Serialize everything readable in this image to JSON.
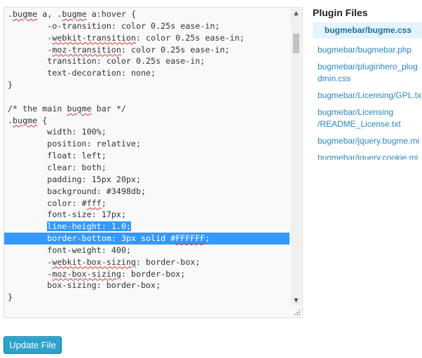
{
  "editor": {
    "lines": [
      [
        {
          "t": ".",
          "s": false
        },
        {
          "t": "bugme",
          "s": true
        },
        {
          "t": " a, .",
          "s": false
        },
        {
          "t": "bugme",
          "s": true
        },
        {
          "t": " a:hover {",
          "s": false
        }
      ],
      [
        {
          "t": "        -o-transition: color 0.25s ease-in;",
          "s": false
        }
      ],
      [
        {
          "t": "        -",
          "s": false
        },
        {
          "t": "webkit-transition",
          "s": true
        },
        {
          "t": ": color 0.25s ease-in;",
          "s": false
        }
      ],
      [
        {
          "t": "        -",
          "s": false
        },
        {
          "t": "moz-transition",
          "s": true
        },
        {
          "t": ": color 0.25s ease-in;",
          "s": false
        }
      ],
      [
        {
          "t": "        transition: color 0.25s ease-in;",
          "s": false
        }
      ],
      [
        {
          "t": "        text-decoration: none;",
          "s": false
        }
      ],
      [
        {
          "t": "}",
          "s": false
        }
      ],
      [
        {
          "t": "",
          "s": false
        }
      ],
      [
        {
          "t": "/* the main ",
          "s": false
        },
        {
          "t": "bugme",
          "s": true
        },
        {
          "t": " bar */",
          "s": false
        }
      ],
      [
        {
          "t": ".",
          "s": false
        },
        {
          "t": "bugme",
          "s": true
        },
        {
          "t": " {",
          "s": false
        }
      ],
      [
        {
          "t": "        width: 100%;",
          "s": false
        }
      ],
      [
        {
          "t": "        position: relative;",
          "s": false
        }
      ],
      [
        {
          "t": "        float: left;",
          "s": false
        }
      ],
      [
        {
          "t": "        clear: both;",
          "s": false
        }
      ],
      [
        {
          "t": "        padding: 15px 20px;",
          "s": false
        }
      ],
      [
        {
          "t": "        background: #3498db;",
          "s": false
        }
      ],
      [
        {
          "t": "        color: #",
          "s": false
        },
        {
          "t": "fff",
          "s": true
        },
        {
          "t": ";",
          "s": false
        }
      ],
      [
        {
          "t": "        font-size: 17px;",
          "s": false
        }
      ],
      [
        {
          "t": "        line-height: 1.0;",
          "s": false
        }
      ],
      [
        {
          "t": "        border-bottom: 3px solid #",
          "s": false
        },
        {
          "t": "FFFFFF",
          "s": true
        },
        {
          "t": ";",
          "s": false
        }
      ],
      [
        {
          "t": "        font-weight: 400;",
          "s": false
        }
      ],
      [
        {
          "t": "        -",
          "s": false
        },
        {
          "t": "webkit-box-sizing",
          "s": true
        },
        {
          "t": ": border-box;",
          "s": false
        }
      ],
      [
        {
          "t": "        -",
          "s": false
        },
        {
          "t": "moz-box-sizing",
          "s": true
        },
        {
          "t": ": border-box;",
          "s": false
        }
      ],
      [
        {
          "t": "        box-sizing: border-box;",
          "s": false
        }
      ],
      [
        {
          "t": "}",
          "s": false
        }
      ],
      [
        {
          "t": "",
          "s": false
        }
      ]
    ],
    "selection_partial_line": 18,
    "selection_full_line": 19,
    "scroll_up_icon": "▲",
    "scroll_down_icon": "▼"
  },
  "update_button": {
    "label": "Update File"
  },
  "sidebar": {
    "title": "Plugin Files",
    "files": [
      {
        "lines": [
          "bugmebar/bugme.css"
        ],
        "active": true
      },
      {
        "lines": [
          "bugmebar/bugmebar.php"
        ],
        "active": false
      },
      {
        "lines": [
          "bugmebar/pluginhero_plug",
          "dmin.css"
        ],
        "active": false
      },
      {
        "lines": [
          "bugmebar/Licensing/GPL.tx"
        ],
        "active": false
      },
      {
        "lines": [
          "bugmebar/Licensing",
          "/README_License.txt"
        ],
        "active": false
      },
      {
        "lines": [
          "bugmebar/jquery.bugme.mi"
        ],
        "active": false
      },
      {
        "lines": [
          "bugmebar/jquery.cookie.mi"
        ],
        "active": false
      }
    ]
  },
  "colors": {
    "selection": "#3399ff",
    "link": "#2a86c0",
    "button": "#2ea2cc"
  }
}
